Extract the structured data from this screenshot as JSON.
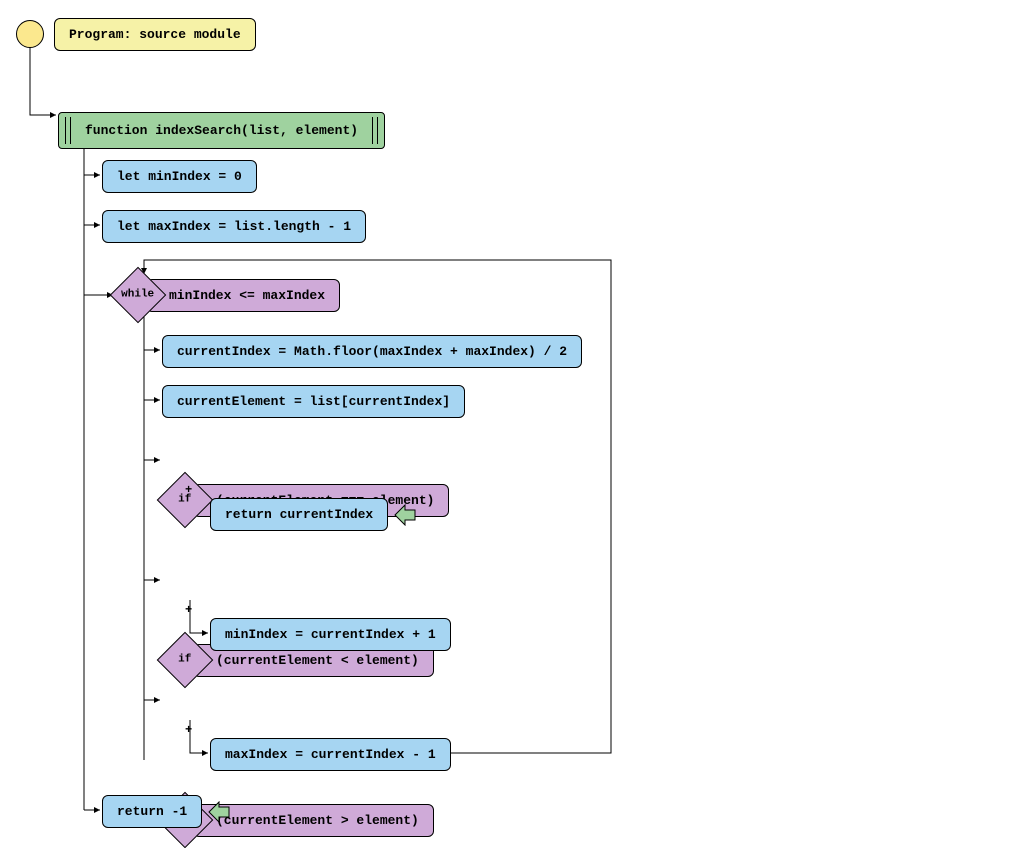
{
  "program": {
    "title": "Program: source module"
  },
  "function": {
    "signature": "function indexSearch(list, element)"
  },
  "stmts": {
    "minInit": "let minIndex = 0",
    "maxInit": "let maxIndex = list.length - 1",
    "whileKeyword": "while",
    "whileCond": "minIndex <= maxIndex",
    "currentIndex": "currentIndex = Math.floor(maxIndex + maxIndex) / 2",
    "currentElement": "currentElement = list[currentIndex]",
    "ifKeyword": "if",
    "if1Cond": "(currentElement === element)",
    "if1Body": "return currentIndex",
    "if2Cond": "(currentElement < element)",
    "if2Body": "minIndex = currentIndex + 1",
    "if3Cond": "(currentElement > element)",
    "if3Body": "maxIndex = currentIndex - 1",
    "returnNeg": "return -1",
    "plus": "+"
  },
  "colors": {
    "yellow": "#f6f2a7",
    "green": "#9fd29f",
    "blue": "#a6d5f2",
    "purple": "#cfaad8"
  }
}
